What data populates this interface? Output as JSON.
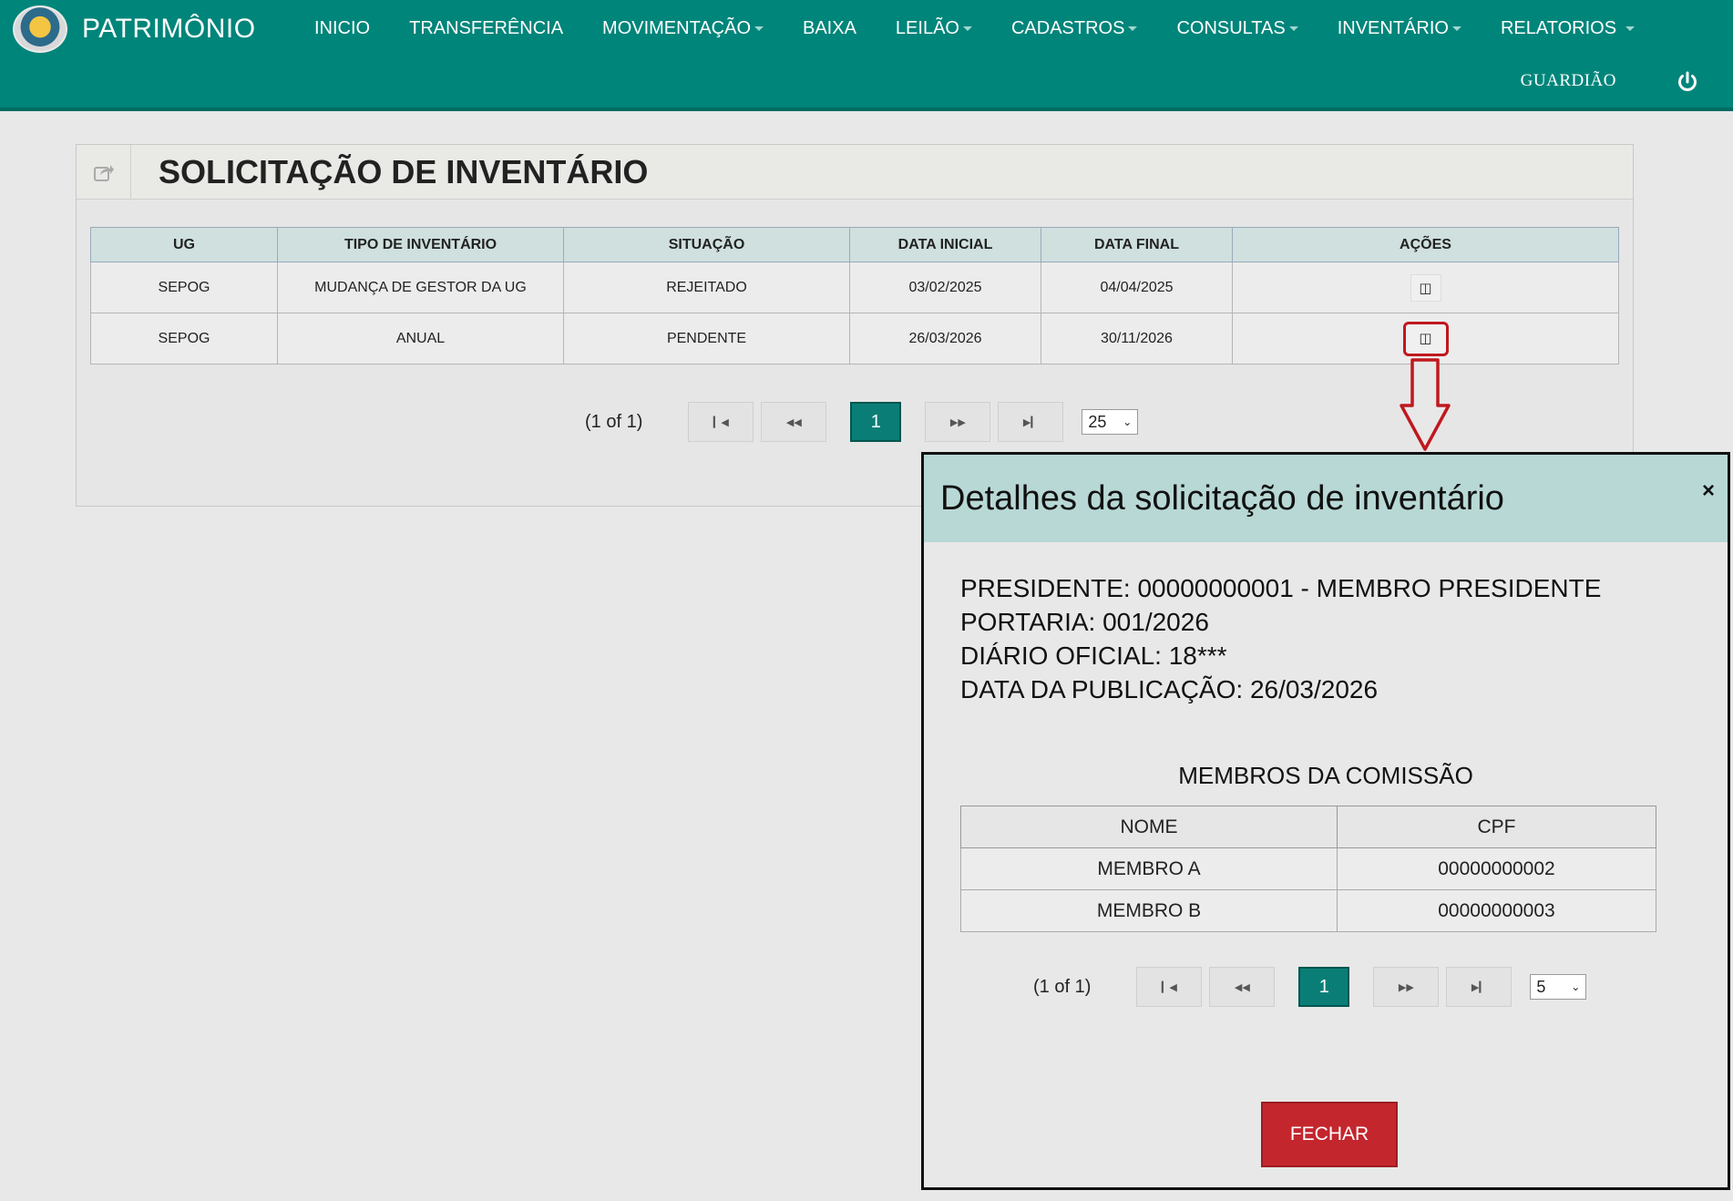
{
  "app": {
    "name": "PATRIMÔNIO",
    "user": "GUARDIÃO"
  },
  "menu": [
    {
      "label": "INICIO",
      "dropdown": false
    },
    {
      "label": "TRANSFERÊNCIA",
      "dropdown": false
    },
    {
      "label": "MOVIMENTAÇÃO",
      "dropdown": true
    },
    {
      "label": "BAIXA",
      "dropdown": false
    },
    {
      "label": "LEILÃO",
      "dropdown": true
    },
    {
      "label": "CADASTROS",
      "dropdown": true
    },
    {
      "label": "CONSULTAS",
      "dropdown": true
    },
    {
      "label": "INVENTÁRIO",
      "dropdown": true
    },
    {
      "label": "RELATORIOS",
      "dropdown": true
    }
  ],
  "page": {
    "title": "SOLICITAÇÃO DE INVENTÁRIO"
  },
  "table": {
    "headers": [
      "UG",
      "TIPO DE INVENTÁRIO",
      "SITUAÇÃO",
      "DATA INICIAL",
      "DATA FINAL",
      "AÇÕES"
    ],
    "rows": [
      [
        "SEPOG",
        "MUDANÇA DE GESTOR DA UG",
        "REJEITADO",
        "03/02/2025",
        "04/04/2025"
      ],
      [
        "SEPOG",
        "ANUAL",
        "PENDENTE",
        "26/03/2026",
        "30/11/2026"
      ]
    ],
    "action_icon": "details-icon"
  },
  "pager_main": {
    "text": "(1 of 1)",
    "current": "1",
    "rows_per_page": "25"
  },
  "modal": {
    "title": "Detalhes da solicitação de inventário",
    "close": "×",
    "info": [
      "PRESIDENTE: 00000000001 - MEMBRO PRESIDENTE",
      "PORTARIA: 001/2026",
      "DIÁRIO OFICIAL: 18***",
      "DATA DA PUBLICAÇÃO: 26/03/2026"
    ],
    "members_title": "MEMBROS DA COMISSÃO",
    "members_headers": [
      "NOME",
      "CPF"
    ],
    "members": [
      [
        "MEMBRO A",
        "00000000002"
      ],
      [
        "MEMBRO B",
        "00000000003"
      ]
    ],
    "pager": {
      "text": "(1 of 1)",
      "current": "1",
      "rows_per_page": "5"
    },
    "close_button": "FECHAR"
  },
  "colors": {
    "navbar": "#00857a",
    "accent": "#0a7e76",
    "danger": "#c4262e",
    "modal_header": "#b8d8d5"
  }
}
